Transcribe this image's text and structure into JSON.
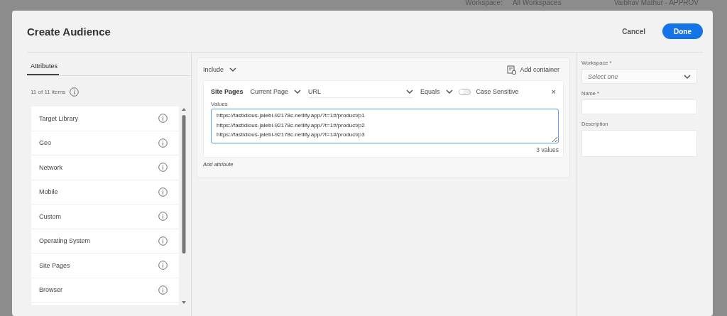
{
  "backdrop": {
    "workspace_label": "Workspace:",
    "workspace_value": "All Workspaces",
    "user": "Vaibhav Mathur - APPROV"
  },
  "dialog": {
    "title": "Create Audience",
    "buttons": [
      {
        "label": "Cancel",
        "kind": "secondary"
      },
      {
        "label": "Done",
        "kind": "primary"
      }
    ]
  },
  "attributes": {
    "tabs": [
      {
        "label": "Attributes",
        "selected": true
      }
    ],
    "count": "11 of 11 items",
    "items": [
      {
        "label": "Target Library"
      },
      {
        "label": "Geo"
      },
      {
        "label": "Network"
      },
      {
        "label": "Mobile"
      },
      {
        "label": "Custom"
      },
      {
        "label": "Operating System"
      },
      {
        "label": "Site Pages"
      },
      {
        "label": "Browser"
      }
    ]
  },
  "rule": {
    "include": "Include",
    "add_container": "Add container",
    "attribute": "Site Pages",
    "scope": "Current Page",
    "field": "URL",
    "operator": "Equals",
    "case_sensitive": {
      "label": "Case Sensitive",
      "on": false
    },
    "close": "×",
    "values_label": "Values",
    "values": [
      "https://fastidious-jalebi-92178c.netlify.app/?t=1#/product/p1",
      "https://fastidious-jalebi-92178c.netlify.app/?t=1#/product/p2",
      "https://fastidious-jalebi-92178c.netlify.app/?t=1#/product/p3"
    ],
    "values_count": "3 values",
    "add_attribute": "Add attribute"
  },
  "details": {
    "fields": [
      {
        "label": "Workspace *",
        "kind": "select",
        "placeholder": "Select one"
      },
      {
        "label": "Name *",
        "kind": "input"
      },
      {
        "label": "Description",
        "kind": "textarea"
      }
    ]
  }
}
